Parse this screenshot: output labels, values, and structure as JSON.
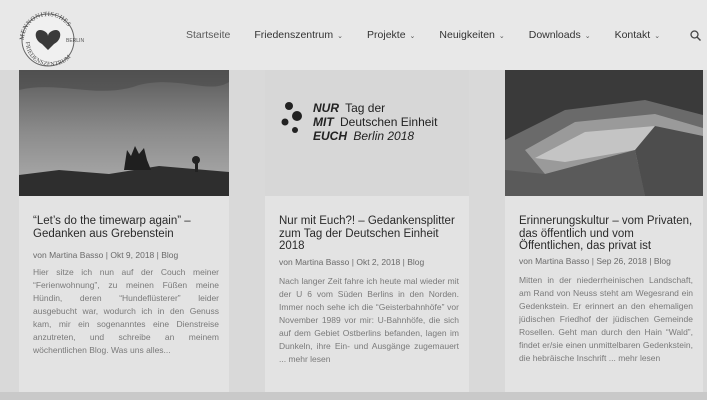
{
  "logo": {
    "arc_top": "MENNONITISCHES",
    "arc_bottom": "FRIEDENSZENTRUM",
    "city": "BERLIN"
  },
  "nav": {
    "items": [
      {
        "label": "Startseite",
        "dropdown": false
      },
      {
        "label": "Friedenszentrum",
        "dropdown": true
      },
      {
        "label": "Projekte",
        "dropdown": true
      },
      {
        "label": "Neuigkeiten",
        "dropdown": true
      },
      {
        "label": "Downloads",
        "dropdown": true
      },
      {
        "label": "Kontakt",
        "dropdown": true
      }
    ],
    "chevron": "⌄",
    "search_icon": "search-icon"
  },
  "posts": [
    {
      "title": "“Let’s do the timewarp again” – Gedanken aus Grebenstein",
      "meta": "von Martina Basso | Okt 9, 2018 | Blog",
      "excerpt": "Hier sitze ich nun auf der Couch meiner “Ferienwohnung”, zu meinen Füßen meine Hündin, deren “Hundeflüsterer” leider ausgebucht war, wodurch ich in den Genuss kam, mir ein sogenanntes eine Dienstreise anzutreten, und schreibe an meinem wöchentlichen Blog. Was uns alles..."
    },
    {
      "title": "Nur mit Euch?! – Gedankensplitter zum Tag der Deutschen Einheit 2018",
      "meta": "von Martina Basso | Okt 2, 2018 | Blog",
      "excerpt": "Nach langer Zeit fahre ich heute mal wieder mit der U 6 vom Süden Berlins in den Norden. Immer noch sehe ich die “Geisterbahnhöfe” vor November 1989 vor mir: U-Bahnhöfe, die sich auf dem Gebiet Ostberlins befanden, lagen im Dunkeln, ihre Ein- und Ausgänge zugemauert ... mehr lesen",
      "image_text": {
        "line1_bold": "NUR",
        "line1_rest": "Tag der",
        "line2_bold": "MIT",
        "line2_rest": "Deutschen Einheit",
        "line3_bold": "EUCH",
        "line3_rest": "Berlin 2018"
      }
    },
    {
      "title": "Erinnerungskultur – vom Privaten, das öffentlich und vom Öffentlichen, das privat ist",
      "meta": "von Martina Basso | Sep 26, 2018 | Blog",
      "excerpt": "Mitten in der niederrheinischen Landschaft, am Rand von Neuss steht am Wegesrand ein Gedenkstein. Er erinnert an den ehemaligen jüdischen Friedhof der jüdischen Gemeinde Rosellen. Geht man durch den Hain “Wald”, findet er/sie einen unmittelbaren Gedenkstein, die hebräische Inschrift ... mehr lesen"
    }
  ]
}
